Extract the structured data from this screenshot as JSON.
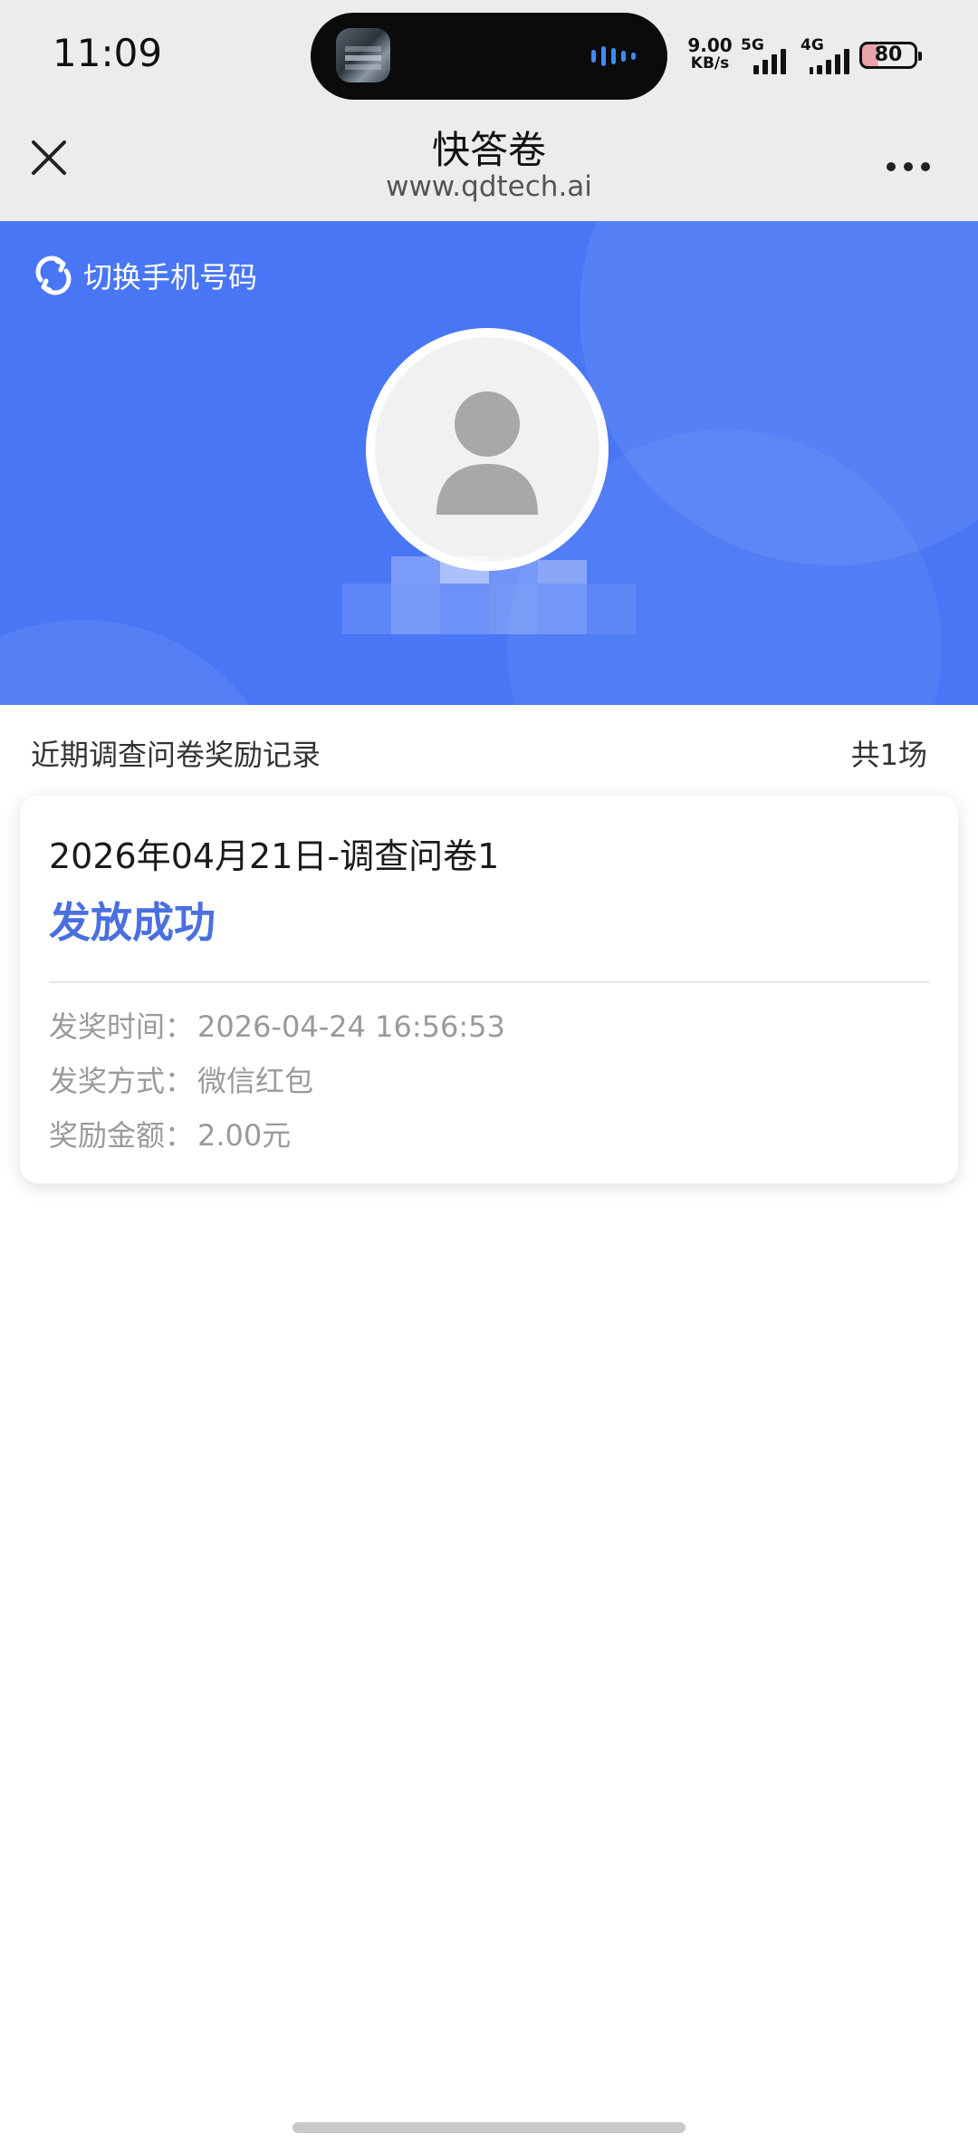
{
  "status_bar": {
    "time": "11:09",
    "net_speed_value": "9.00",
    "net_speed_unit": "KB/s",
    "signal_1_label": "5G",
    "signal_2_label": "4G",
    "battery_level": "80",
    "wave_color": "#3d8bff"
  },
  "title_bar": {
    "title": "快答卷",
    "url": "www.qdtech.ai",
    "close_icon": "close-icon",
    "more_icon": "more-dots-icon"
  },
  "hero": {
    "switch_phone_label": "切换手机号码",
    "switch_icon": "refresh-icon",
    "avatar_icon": "user-avatar-icon",
    "background_color": "#4876f5"
  },
  "records": {
    "title": "近期调查问卷奖励记录",
    "count": "共1场",
    "items": [
      {
        "title": "2026年04月21日-调查问卷1",
        "status": "发放成功",
        "status_color": "#4a6fdf",
        "details": [
          {
            "label": "发奖时间：",
            "value": "2026-04-24 16:56:53"
          },
          {
            "label": "发奖方式：",
            "value": "微信红包"
          },
          {
            "label": "奖励金额：",
            "value": "2.00元"
          }
        ]
      }
    ]
  }
}
